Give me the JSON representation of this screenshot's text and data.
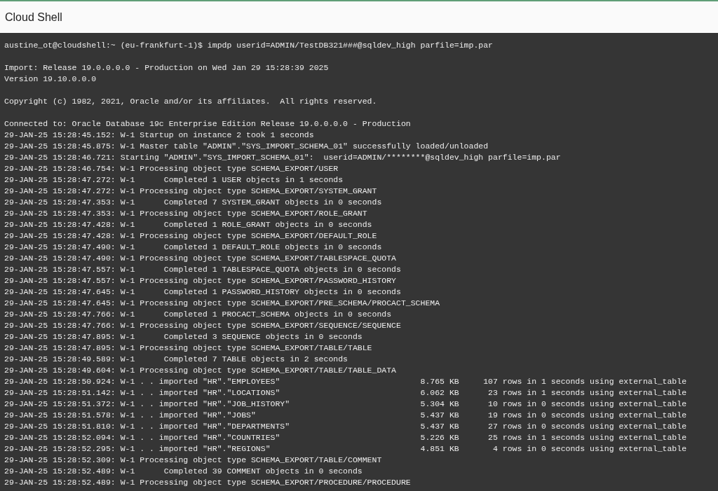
{
  "header": {
    "title": "Cloud Shell"
  },
  "terminal": {
    "blocks": [
      {
        "lines": [
          "austine_ot@cloudshell:~ (eu-frankfurt-1)$ impdp userid=ADMIN/TestDB321###@sqldev_high parfile=imp.par"
        ]
      },
      {
        "lines": [
          "Import: Release 19.0.0.0.0 - Production on Wed Jan 29 15:28:39 2025",
          "Version 19.10.0.0.0"
        ]
      },
      {
        "lines": [
          "Copyright (c) 1982, 2021, Oracle and/or its affiliates.  All rights reserved."
        ]
      },
      {
        "lines": [
          "Connected to: Oracle Database 19c Enterprise Edition Release 19.0.0.0.0 - Production",
          "29-JAN-25 15:28:45.152: W-1 Startup on instance 2 took 1 seconds",
          "29-JAN-25 15:28:45.875: W-1 Master table \"ADMIN\".\"SYS_IMPORT_SCHEMA_01\" successfully loaded/unloaded",
          "29-JAN-25 15:28:46.721: Starting \"ADMIN\".\"SYS_IMPORT_SCHEMA_01\":  userid=ADMIN/********@sqldev_high parfile=imp.par",
          "29-JAN-25 15:28:46.754: W-1 Processing object type SCHEMA_EXPORT/USER",
          "29-JAN-25 15:28:47.272: W-1      Completed 1 USER objects in 1 seconds",
          "29-JAN-25 15:28:47.272: W-1 Processing object type SCHEMA_EXPORT/SYSTEM_GRANT",
          "29-JAN-25 15:28:47.353: W-1      Completed 7 SYSTEM_GRANT objects in 0 seconds",
          "29-JAN-25 15:28:47.353: W-1 Processing object type SCHEMA_EXPORT/ROLE_GRANT",
          "29-JAN-25 15:28:47.428: W-1      Completed 1 ROLE_GRANT objects in 0 seconds",
          "29-JAN-25 15:28:47.428: W-1 Processing object type SCHEMA_EXPORT/DEFAULT_ROLE",
          "29-JAN-25 15:28:47.490: W-1      Completed 1 DEFAULT_ROLE objects in 0 seconds",
          "29-JAN-25 15:28:47.490: W-1 Processing object type SCHEMA_EXPORT/TABLESPACE_QUOTA",
          "29-JAN-25 15:28:47.557: W-1      Completed 1 TABLESPACE_QUOTA objects in 0 seconds",
          "29-JAN-25 15:28:47.557: W-1 Processing object type SCHEMA_EXPORT/PASSWORD_HISTORY",
          "29-JAN-25 15:28:47.645: W-1      Completed 1 PASSWORD_HISTORY objects in 0 seconds",
          "29-JAN-25 15:28:47.645: W-1 Processing object type SCHEMA_EXPORT/PRE_SCHEMA/PROCACT_SCHEMA",
          "29-JAN-25 15:28:47.766: W-1      Completed 1 PROCACT_SCHEMA objects in 0 seconds",
          "29-JAN-25 15:28:47.766: W-1 Processing object type SCHEMA_EXPORT/SEQUENCE/SEQUENCE",
          "29-JAN-25 15:28:47.895: W-1      Completed 3 SEQUENCE objects in 0 seconds",
          "29-JAN-25 15:28:47.895: W-1 Processing object type SCHEMA_EXPORT/TABLE/TABLE",
          "29-JAN-25 15:28:49.589: W-1      Completed 7 TABLE objects in 2 seconds",
          "29-JAN-25 15:28:49.604: W-1 Processing object type SCHEMA_EXPORT/TABLE/TABLE_DATA",
          "29-JAN-25 15:28:50.924: W-1 . . imported \"HR\".\"EMPLOYEES\"                             8.765 KB     107 rows in 1 seconds using external_table",
          "29-JAN-25 15:28:51.142: W-1 . . imported \"HR\".\"LOCATIONS\"                             6.062 KB      23 rows in 1 seconds using external_table",
          "29-JAN-25 15:28:51.372: W-1 . . imported \"HR\".\"JOB_HISTORY\"                           5.304 KB      10 rows in 0 seconds using external_table",
          "29-JAN-25 15:28:51.578: W-1 . . imported \"HR\".\"JOBS\"                                  5.437 KB      19 rows in 0 seconds using external_table",
          "29-JAN-25 15:28:51.810: W-1 . . imported \"HR\".\"DEPARTMENTS\"                           5.437 KB      27 rows in 0 seconds using external_table",
          "29-JAN-25 15:28:52.094: W-1 . . imported \"HR\".\"COUNTRIES\"                             5.226 KB      25 rows in 1 seconds using external_table",
          "29-JAN-25 15:28:52.295: W-1 . . imported \"HR\".\"REGIONS\"                               4.851 KB       4 rows in 0 seconds using external_table",
          "29-JAN-25 15:28:52.309: W-1 Processing object type SCHEMA_EXPORT/TABLE/COMMENT",
          "29-JAN-25 15:28:52.489: W-1      Completed 39 COMMENT objects in 0 seconds",
          "29-JAN-25 15:28:52.489: W-1 Processing object type SCHEMA_EXPORT/PROCEDURE/PROCEDURE"
        ]
      }
    ]
  }
}
